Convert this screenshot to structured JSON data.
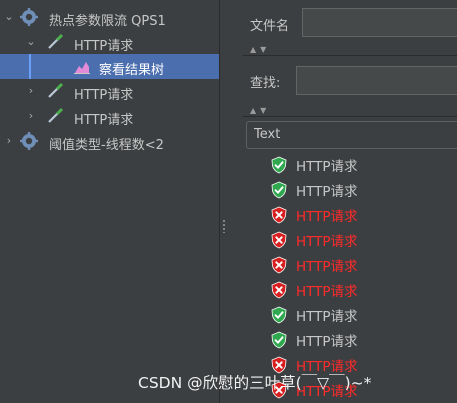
{
  "tree": {
    "items": [
      {
        "label": "热点参数限流 QPS1",
        "type": "thread-group",
        "expanded": true
      },
      {
        "label": "HTTP请求",
        "type": "sampler",
        "expanded": true
      },
      {
        "label": "察看结果树",
        "type": "listener",
        "selected": true
      },
      {
        "label": "HTTP请求",
        "type": "sampler"
      },
      {
        "label": "HTTP请求",
        "type": "sampler"
      },
      {
        "label": "阈值类型-线程数<2",
        "type": "thread-group"
      }
    ]
  },
  "panel": {
    "filename_label": "文件名",
    "search_label": "查找:",
    "renderer_select": "Text"
  },
  "results": [
    {
      "label": "HTTP请求",
      "status": "success"
    },
    {
      "label": "HTTP请求",
      "status": "success"
    },
    {
      "label": "HTTP请求",
      "status": "error"
    },
    {
      "label": "HTTP请求",
      "status": "error"
    },
    {
      "label": "HTTP请求",
      "status": "error"
    },
    {
      "label": "HTTP请求",
      "status": "error"
    },
    {
      "label": "HTTP请求",
      "status": "success"
    },
    {
      "label": "HTTP请求",
      "status": "success"
    },
    {
      "label": "HTTP请求",
      "status": "error"
    },
    {
      "label": "HTTP请求",
      "status": "error"
    }
  ],
  "watermark": "CSDN @欣慰的三叶草(￣▽￣)~*",
  "colors": {
    "success": "#2fa84f",
    "error": "#d81e1e",
    "selection": "#4b6eaf"
  }
}
